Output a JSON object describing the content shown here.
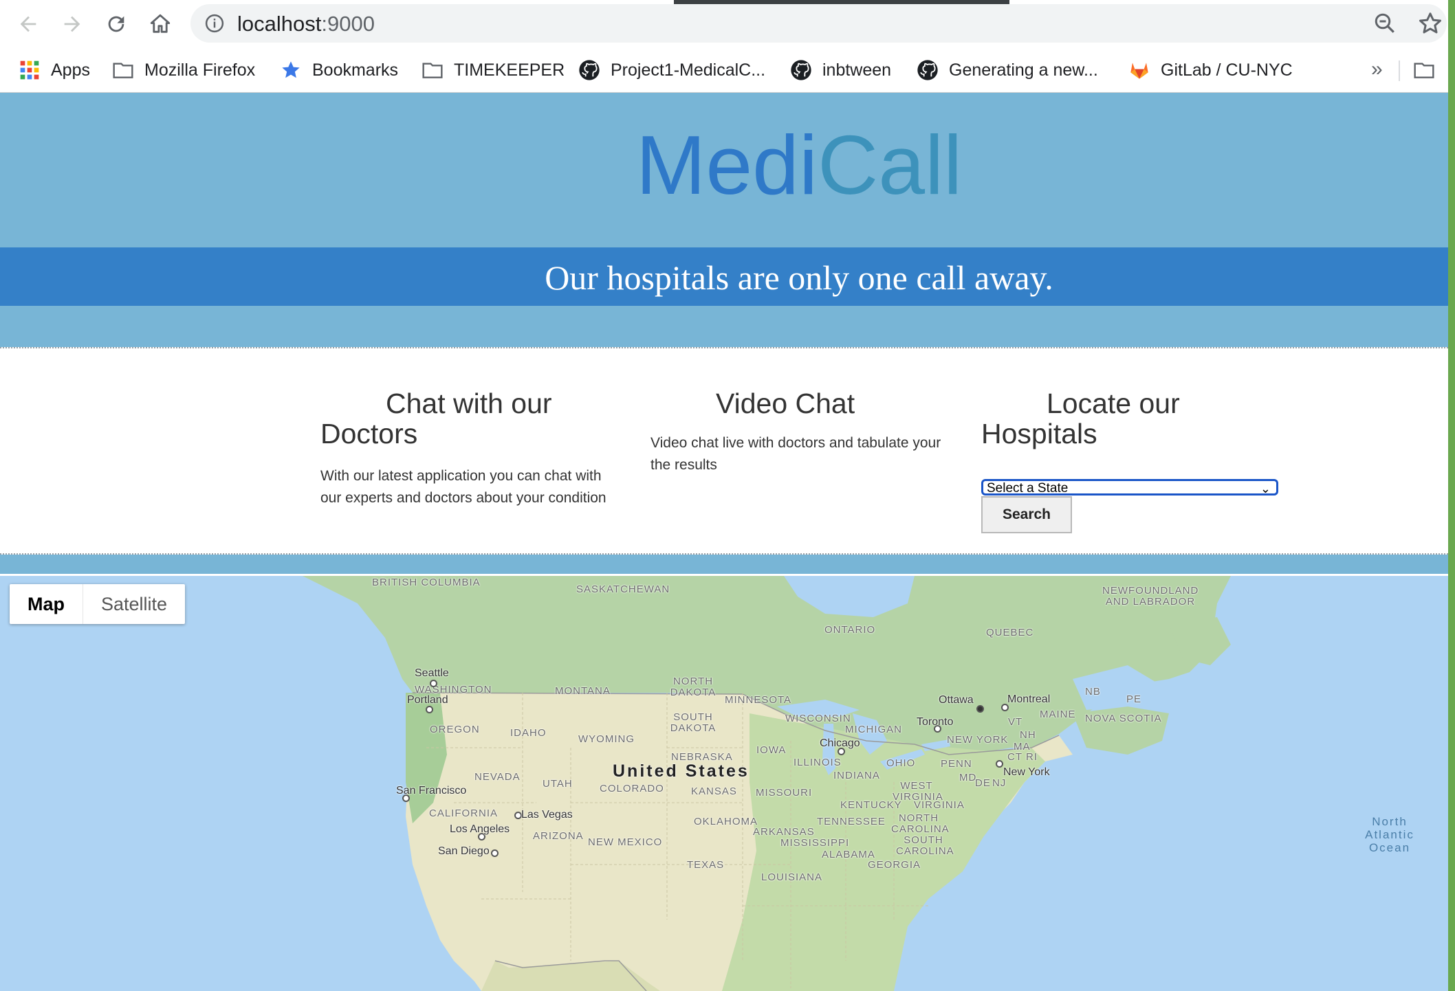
{
  "browser": {
    "url_host": "localhost",
    "url_port": ":9000"
  },
  "bookmarks": [
    {
      "label": "Apps",
      "icon": "apps-grid-icon"
    },
    {
      "label": "Mozilla Firefox",
      "icon": "folder-icon"
    },
    {
      "label": "Bookmarks",
      "icon": "star-icon"
    },
    {
      "label": "TIMEKEEPER",
      "icon": "folder-icon"
    },
    {
      "label": "Project1-MedicalC...",
      "icon": "github-icon"
    },
    {
      "label": "inbtween",
      "icon": "github-icon"
    },
    {
      "label": "Generating a new...",
      "icon": "github-icon"
    },
    {
      "label": "GitLab / CU-NYC",
      "icon": "gitlab-icon"
    }
  ],
  "bookmarks_more": "»",
  "hero": {
    "brand_part1": "Medi",
    "brand_part2": "Call",
    "tagline": "Our hospitals are only one call away."
  },
  "features": {
    "chat": {
      "title": "Chat with our Doctors",
      "text": "With our latest application you can chat with our experts and doctors about your condition"
    },
    "video": {
      "title": "Video Chat",
      "text": "Video chat live with doctors and tabulate your the results"
    },
    "locate": {
      "title": "Locate our Hospitals",
      "select_value": "Select a State",
      "search_label": "Search"
    }
  },
  "map": {
    "type_map": "Map",
    "type_satellite": "Satellite",
    "country": "United States",
    "regions": [
      "BRITISH COLUMBIA",
      "SASKATCHEWAN",
      "NEWFOUNDLAND AND LABRADOR",
      "ONTARIO",
      "QUEBEC",
      "WASHINGTON",
      "MONTANA",
      "NORTH DAKOTA",
      "MINNESOTA",
      "OREGON",
      "IDAHO",
      "SOUTH DAKOTA",
      "WYOMING",
      "WISCONSIN",
      "MICHIGAN",
      "NEBRASKA",
      "IOWA",
      "ILLINOIS",
      "NEVADA",
      "UTAH",
      "COLORADO",
      "KANSAS",
      "MISSOURI",
      "INDIANA",
      "OHIO",
      "PENN",
      "NEW YORK",
      "CALIFORNIA",
      "OKLAHOMA",
      "KENTUCKY",
      "WEST VIRGINIA",
      "VIRGINIA",
      "TENNESSEE",
      "NORTH CAROLINA",
      "ARIZONA",
      "NEW MEXICO",
      "ARKANSAS",
      "MISSISSIPPI",
      "ALABAMA",
      "SOUTH CAROLINA",
      "GEORGIA",
      "TEXAS",
      "LOUISIANA",
      "MAINE",
      "NB",
      "PE",
      "NOVA SCOTIA",
      "VT",
      "NH",
      "MA",
      "CT",
      "RI",
      "MD",
      "DE",
      "NJ"
    ],
    "cities": [
      "Seattle",
      "Portland",
      "San Francisco",
      "Las Vegas",
      "Los Angeles",
      "San Diego",
      "Chicago",
      "Toronto",
      "Ottawa",
      "Montreal",
      "New York"
    ],
    "water": "North Atlantic Ocean"
  }
}
